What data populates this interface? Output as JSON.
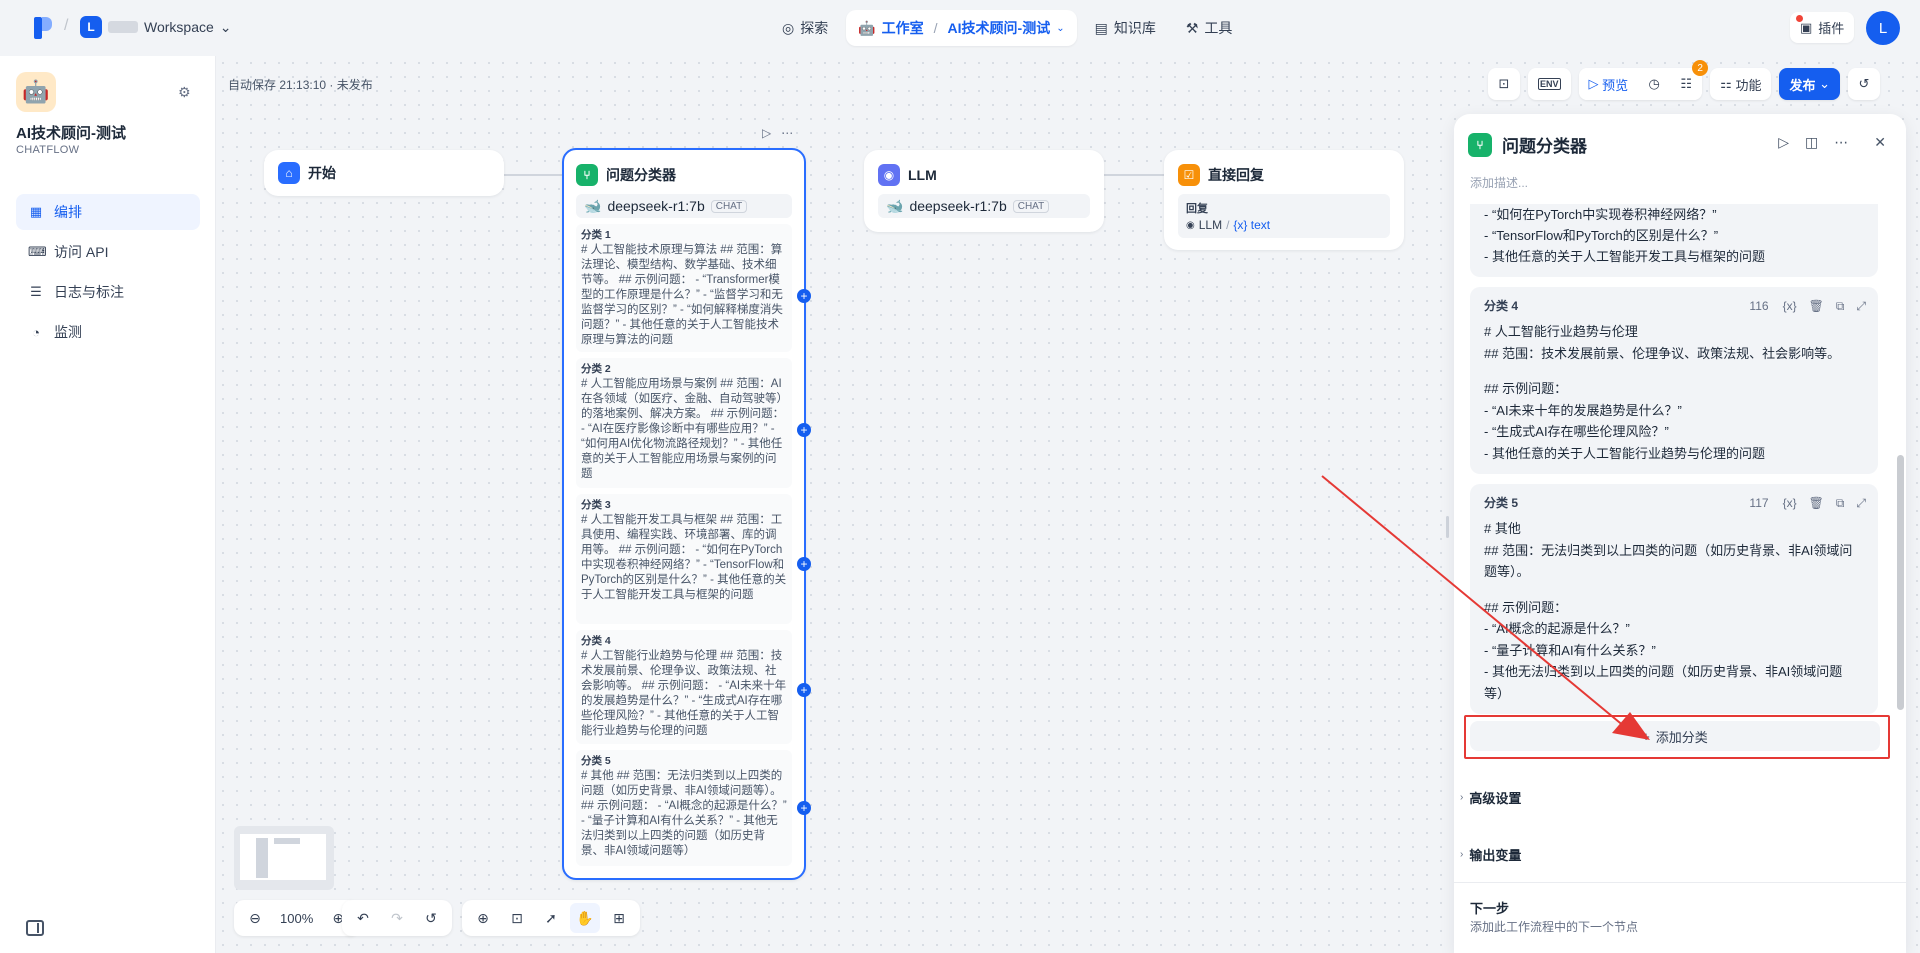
{
  "topbar": {
    "workspace_initial": "L",
    "workspace_name": "Workspace",
    "nav": {
      "explore": "探索",
      "studio": "工作室",
      "app_breadcrumb": "AI技术顾问-测试",
      "knowledge": "知识库",
      "tools": "工具"
    },
    "plugins": "插件",
    "user_initial": "L"
  },
  "sidebar": {
    "app_name": "AI技术顾问-测试",
    "app_type": "CHATFLOW",
    "items": [
      {
        "label": "编排",
        "icon": "orchestrate-icon"
      },
      {
        "label": "访问 API",
        "icon": "api-icon"
      },
      {
        "label": "日志与标注",
        "icon": "logs-icon"
      },
      {
        "label": "监测",
        "icon": "monitor-icon"
      }
    ]
  },
  "canvas": {
    "autosave": "自动保存 21:13:10 · 未发布",
    "toolbar": {
      "env": "ENV",
      "preview": "预览",
      "checklist_badge": "2",
      "features": "功能",
      "publish": "发布"
    },
    "zoom": "100%"
  },
  "nodes": {
    "start": {
      "title": "开始"
    },
    "classifier": {
      "title": "问题分类器",
      "model": "deepseek-r1:7b",
      "model_tag": "CHAT",
      "classes": [
        {
          "title": "分类 1",
          "text": "# 人工智能技术原理与算法 ## 范围：算法理论、模型结构、数学基础、技术细节等。 ## 示例问题： - “Transformer模型的工作原理是什么？” - “监督学习和无监督学习的区别？” - “如何解释梯度消失问题？” - 其他任意的关于人工智能技术原理与算法的问题"
        },
        {
          "title": "分类 2",
          "text": "# 人工智能应用场景与案例 ## 范围：AI在各领域（如医疗、金融、自动驾驶等）的落地案例、解决方案。 ## 示例问题： - “AI在医疗影像诊断中有哪些应用？” - “如何用AI优化物流路径规划？” - 其他任意的关于人工智能应用场景与案例的问题"
        },
        {
          "title": "分类 3",
          "text": "# 人工智能开发工具与框架 ## 范围：工具使用、编程实践、环境部署、库的调用等。 ## 示例问题： - “如何在PyTorch中实现卷积神经网络？” - “TensorFlow和PyTorch的区别是什么？” - 其他任意的关于人工智能开发工具与框架的问题"
        },
        {
          "title": "分类 4",
          "text": "# 人工智能行业趋势与伦理 ## 范围：技术发展前景、伦理争议、政策法规、社会影响等。 ## 示例问题： - “AI未来十年的发展趋势是什么？” - “生成式AI存在哪些伦理风险？” - 其他任意的关于人工智能行业趋势与伦理的问题"
        },
        {
          "title": "分类 5",
          "text": "# 其他 ## 范围：无法归类到以上四类的问题（如历史背景、非AI领域问题等）。 ## 示例问题： - “AI概念的起源是什么？” - “量子计算和AI有什么关系？” - 其他无法归类到以上四类的问题（如历史背景、非AI领域问题等）"
        }
      ]
    },
    "llm": {
      "title": "LLM",
      "model": "deepseek-r1:7b",
      "model_tag": "CHAT"
    },
    "reply": {
      "title": "直接回复",
      "label": "回复",
      "source": "LLM",
      "slash": "/",
      "var": "{x} text"
    }
  },
  "panel": {
    "title": "问题分类器",
    "desc_placeholder": "添加描述...",
    "partial_lines": [
      "- “如何在PyTorch中实现卷积神经网络？”",
      "- “TensorFlow和PyTorch的区别是什么？”",
      "- 其他任意的关于人工智能开发工具与框架的问题"
    ],
    "card4": {
      "title": "分类 4",
      "count": "116",
      "lines": [
        "# 人工智能行业趋势与伦理",
        "## 范围：技术发展前景、伦理争议、政策法规、社会影响等。",
        "",
        "## 示例问题：",
        "- “AI未来十年的发展趋势是什么？”",
        "- “生成式AI存在哪些伦理风险？”",
        "- 其他任意的关于人工智能行业趋势与伦理的问题"
      ]
    },
    "card5": {
      "title": "分类 5",
      "count": "117",
      "lines": [
        "# 其他",
        "## 范围：无法归类到以上四类的问题（如历史背景、非AI领域问",
        "题等）。",
        "",
        "## 示例问题：",
        "- “AI概念的起源是什么？”",
        "- “量子计算和AI有什么关系？”",
        "- 其他无法归类到以上四类的问题（如历史背景、非AI领域问题",
        "等）"
      ]
    },
    "var_icon": "{x}",
    "add_class": "添加分类",
    "advanced": "高级设置",
    "output_vars": "输出变量",
    "next_title": "下一步",
    "next_desc": "添加此工作流程中的下一个节点"
  },
  "colors": {
    "accent": "#155eef",
    "highlight": "#e53935",
    "classifier_icon": "#17b26a",
    "start_icon": "#296dff",
    "llm_icon": "#6172f3",
    "reply_icon": "#f79009"
  }
}
